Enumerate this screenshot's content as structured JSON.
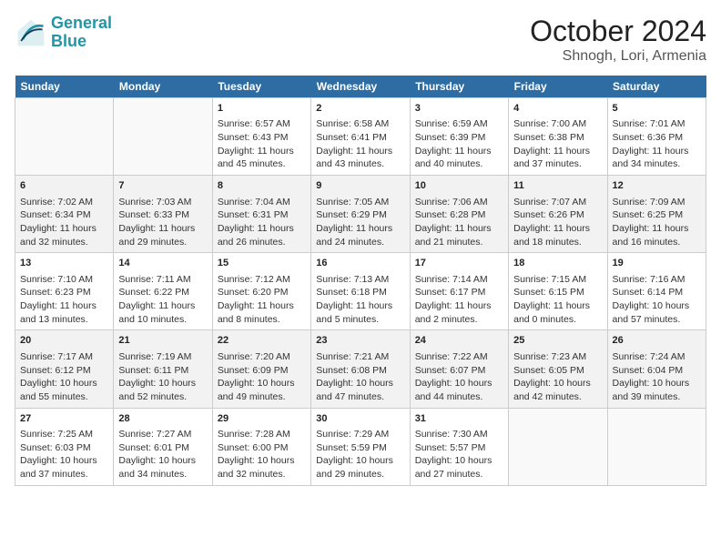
{
  "header": {
    "logo_line1": "General",
    "logo_line2": "Blue",
    "month": "October 2024",
    "location": "Shnogh, Lori, Armenia"
  },
  "weekdays": [
    "Sunday",
    "Monday",
    "Tuesday",
    "Wednesday",
    "Thursday",
    "Friday",
    "Saturday"
  ],
  "weeks": [
    [
      {
        "day": "",
        "info": ""
      },
      {
        "day": "",
        "info": ""
      },
      {
        "day": "1",
        "info": "Sunrise: 6:57 AM\nSunset: 6:43 PM\nDaylight: 11 hours and 45 minutes."
      },
      {
        "day": "2",
        "info": "Sunrise: 6:58 AM\nSunset: 6:41 PM\nDaylight: 11 hours and 43 minutes."
      },
      {
        "day": "3",
        "info": "Sunrise: 6:59 AM\nSunset: 6:39 PM\nDaylight: 11 hours and 40 minutes."
      },
      {
        "day": "4",
        "info": "Sunrise: 7:00 AM\nSunset: 6:38 PM\nDaylight: 11 hours and 37 minutes."
      },
      {
        "day": "5",
        "info": "Sunrise: 7:01 AM\nSunset: 6:36 PM\nDaylight: 11 hours and 34 minutes."
      }
    ],
    [
      {
        "day": "6",
        "info": "Sunrise: 7:02 AM\nSunset: 6:34 PM\nDaylight: 11 hours and 32 minutes."
      },
      {
        "day": "7",
        "info": "Sunrise: 7:03 AM\nSunset: 6:33 PM\nDaylight: 11 hours and 29 minutes."
      },
      {
        "day": "8",
        "info": "Sunrise: 7:04 AM\nSunset: 6:31 PM\nDaylight: 11 hours and 26 minutes."
      },
      {
        "day": "9",
        "info": "Sunrise: 7:05 AM\nSunset: 6:29 PM\nDaylight: 11 hours and 24 minutes."
      },
      {
        "day": "10",
        "info": "Sunrise: 7:06 AM\nSunset: 6:28 PM\nDaylight: 11 hours and 21 minutes."
      },
      {
        "day": "11",
        "info": "Sunrise: 7:07 AM\nSunset: 6:26 PM\nDaylight: 11 hours and 18 minutes."
      },
      {
        "day": "12",
        "info": "Sunrise: 7:09 AM\nSunset: 6:25 PM\nDaylight: 11 hours and 16 minutes."
      }
    ],
    [
      {
        "day": "13",
        "info": "Sunrise: 7:10 AM\nSunset: 6:23 PM\nDaylight: 11 hours and 13 minutes."
      },
      {
        "day": "14",
        "info": "Sunrise: 7:11 AM\nSunset: 6:22 PM\nDaylight: 11 hours and 10 minutes."
      },
      {
        "day": "15",
        "info": "Sunrise: 7:12 AM\nSunset: 6:20 PM\nDaylight: 11 hours and 8 minutes."
      },
      {
        "day": "16",
        "info": "Sunrise: 7:13 AM\nSunset: 6:18 PM\nDaylight: 11 hours and 5 minutes."
      },
      {
        "day": "17",
        "info": "Sunrise: 7:14 AM\nSunset: 6:17 PM\nDaylight: 11 hours and 2 minutes."
      },
      {
        "day": "18",
        "info": "Sunrise: 7:15 AM\nSunset: 6:15 PM\nDaylight: 11 hours and 0 minutes."
      },
      {
        "day": "19",
        "info": "Sunrise: 7:16 AM\nSunset: 6:14 PM\nDaylight: 10 hours and 57 minutes."
      }
    ],
    [
      {
        "day": "20",
        "info": "Sunrise: 7:17 AM\nSunset: 6:12 PM\nDaylight: 10 hours and 55 minutes."
      },
      {
        "day": "21",
        "info": "Sunrise: 7:19 AM\nSunset: 6:11 PM\nDaylight: 10 hours and 52 minutes."
      },
      {
        "day": "22",
        "info": "Sunrise: 7:20 AM\nSunset: 6:09 PM\nDaylight: 10 hours and 49 minutes."
      },
      {
        "day": "23",
        "info": "Sunrise: 7:21 AM\nSunset: 6:08 PM\nDaylight: 10 hours and 47 minutes."
      },
      {
        "day": "24",
        "info": "Sunrise: 7:22 AM\nSunset: 6:07 PM\nDaylight: 10 hours and 44 minutes."
      },
      {
        "day": "25",
        "info": "Sunrise: 7:23 AM\nSunset: 6:05 PM\nDaylight: 10 hours and 42 minutes."
      },
      {
        "day": "26",
        "info": "Sunrise: 7:24 AM\nSunset: 6:04 PM\nDaylight: 10 hours and 39 minutes."
      }
    ],
    [
      {
        "day": "27",
        "info": "Sunrise: 7:25 AM\nSunset: 6:03 PM\nDaylight: 10 hours and 37 minutes."
      },
      {
        "day": "28",
        "info": "Sunrise: 7:27 AM\nSunset: 6:01 PM\nDaylight: 10 hours and 34 minutes."
      },
      {
        "day": "29",
        "info": "Sunrise: 7:28 AM\nSunset: 6:00 PM\nDaylight: 10 hours and 32 minutes."
      },
      {
        "day": "30",
        "info": "Sunrise: 7:29 AM\nSunset: 5:59 PM\nDaylight: 10 hours and 29 minutes."
      },
      {
        "day": "31",
        "info": "Sunrise: 7:30 AM\nSunset: 5:57 PM\nDaylight: 10 hours and 27 minutes."
      },
      {
        "day": "",
        "info": ""
      },
      {
        "day": "",
        "info": ""
      }
    ]
  ]
}
